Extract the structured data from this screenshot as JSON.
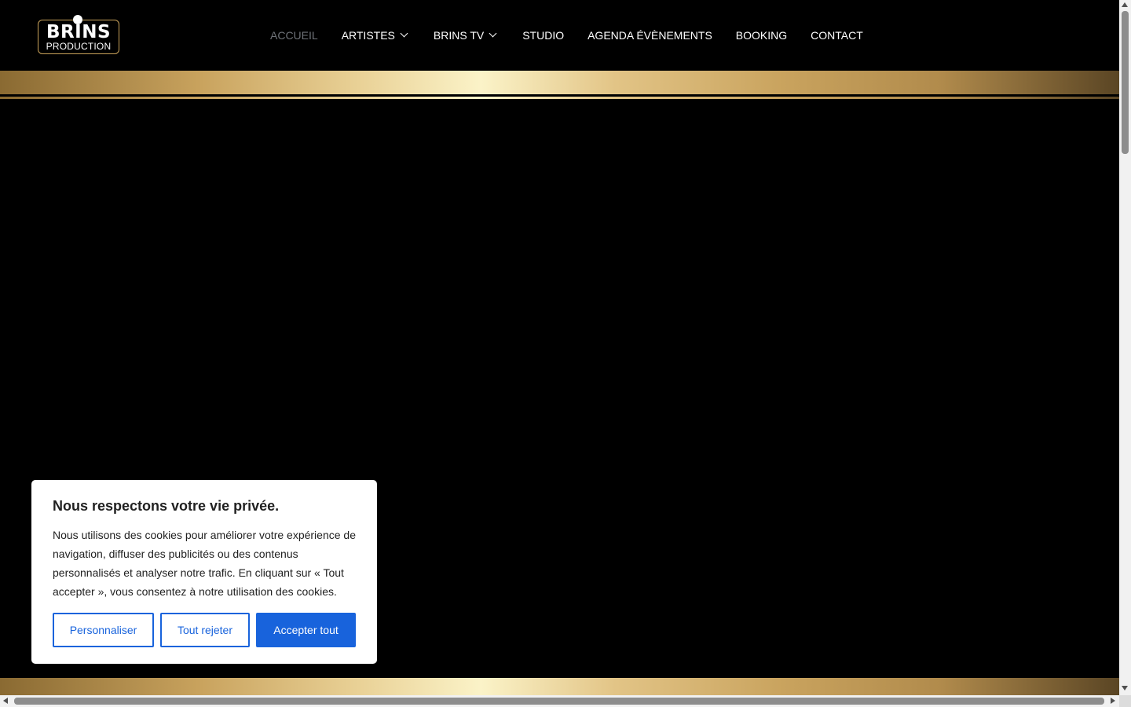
{
  "logo": {
    "main": "BRINS",
    "sub": "PRODUCTION"
  },
  "nav": {
    "items": [
      {
        "label": "ACCUEIL"
      },
      {
        "label": "ARTISTES"
      },
      {
        "label": "BRINS TV"
      },
      {
        "label": "STUDIO"
      },
      {
        "label": "AGENDA ÉVÈNEMENTS"
      },
      {
        "label": "BOOKING"
      },
      {
        "label": "CONTACT"
      }
    ],
    "active_color": "#6f7379"
  },
  "cookie": {
    "title": "Nous respectons votre vie privée.",
    "text": "Nous utilisons des cookies pour améliorer votre expérience de navigation, diffuser des publicités ou des contenus personnalisés et analyser notre trafic. En cliquant sur « Tout accepter », vous consentez à notre utilisation des cookies.",
    "buttons": {
      "customize": "Personnaliser",
      "reject": "Tout rejeter",
      "accept": "Accepter tout"
    },
    "accent_color": "#1863dc"
  },
  "colors": {
    "background": "#000000",
    "gold": "#c9a35e"
  }
}
